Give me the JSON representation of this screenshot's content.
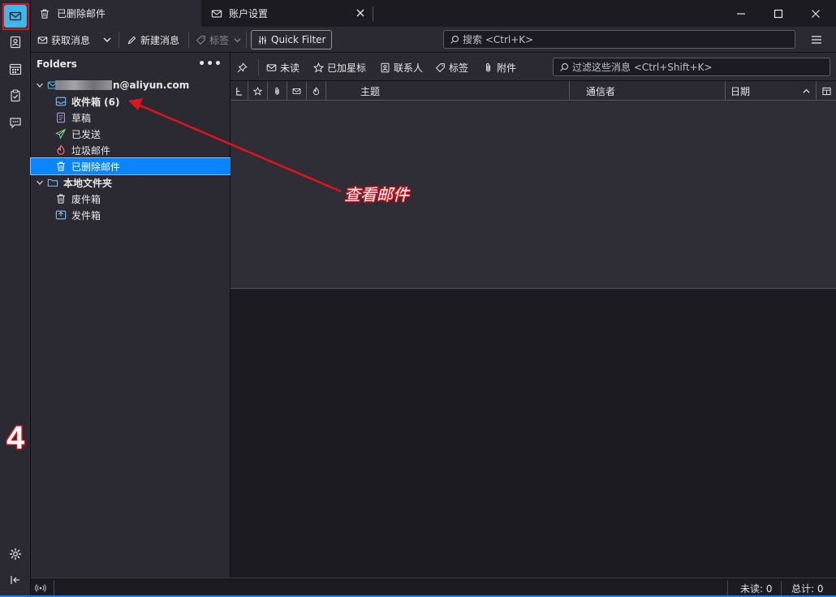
{
  "tabs": [
    {
      "label": "已删除邮件",
      "icon": "trash-icon",
      "active": true
    },
    {
      "label": "账户设置",
      "icon": "envelope-icon",
      "active": false
    }
  ],
  "toolbar": {
    "get_messages": "获取消息",
    "new_message": "新建消息",
    "tag": "标签",
    "quick_filter": "Quick Filter",
    "search_placeholder": "搜索 <Ctrl+K>"
  },
  "folder_pane": {
    "header": "Folders",
    "account_suffix": "n@aliyun.com",
    "folders": [
      {
        "label": "收件箱 (6)",
        "icon": "inbox-icon",
        "bold": true
      },
      {
        "label": "草稿",
        "icon": "draft-icon"
      },
      {
        "label": "已发送",
        "icon": "sent-icon"
      },
      {
        "label": "垃圾邮件",
        "icon": "junk-icon"
      },
      {
        "label": "已删除邮件",
        "icon": "trash-icon",
        "selected": true
      }
    ],
    "local_folders": {
      "label": "本地文件夹",
      "children": [
        {
          "label": "废件箱",
          "icon": "trash-icon"
        },
        {
          "label": "发件箱",
          "icon": "outbox-icon"
        }
      ]
    }
  },
  "quick_filter_bar": {
    "unread": "未读",
    "starred": "已加星标",
    "contacts": "联系人",
    "tags": "标签",
    "attachments": "附件",
    "filter_placeholder": "过滤这些消息 <Ctrl+Shift+K>"
  },
  "thread_columns": {
    "subject": "主题",
    "correspondent": "通信者",
    "date": "日期"
  },
  "status_bar": {
    "unread_label": "未读:",
    "unread_count": "0",
    "total_label": "总计:",
    "total_count": "0"
  },
  "annotation": {
    "text": "查看邮件",
    "step_number": "4",
    "color": "#e0141c"
  },
  "colors": {
    "accent": "#0a84ff",
    "mail_space": "#3fb6e8"
  }
}
